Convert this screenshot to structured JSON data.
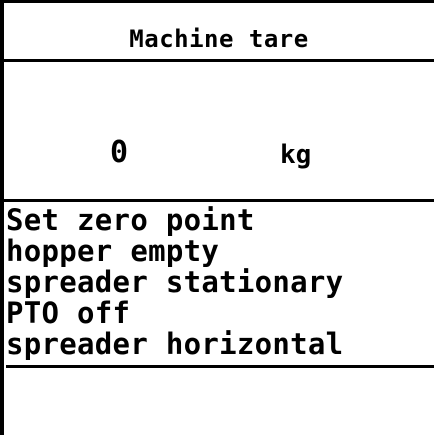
{
  "screen": {
    "title": "Machine tare",
    "value": "0",
    "unit": "kg",
    "instructions": [
      "Set zero point",
      "hopper empty",
      "spreader stationary",
      "PTO off",
      "spreader horizontal"
    ]
  },
  "colors": {
    "background": "#ffffff",
    "foreground": "#000000"
  }
}
